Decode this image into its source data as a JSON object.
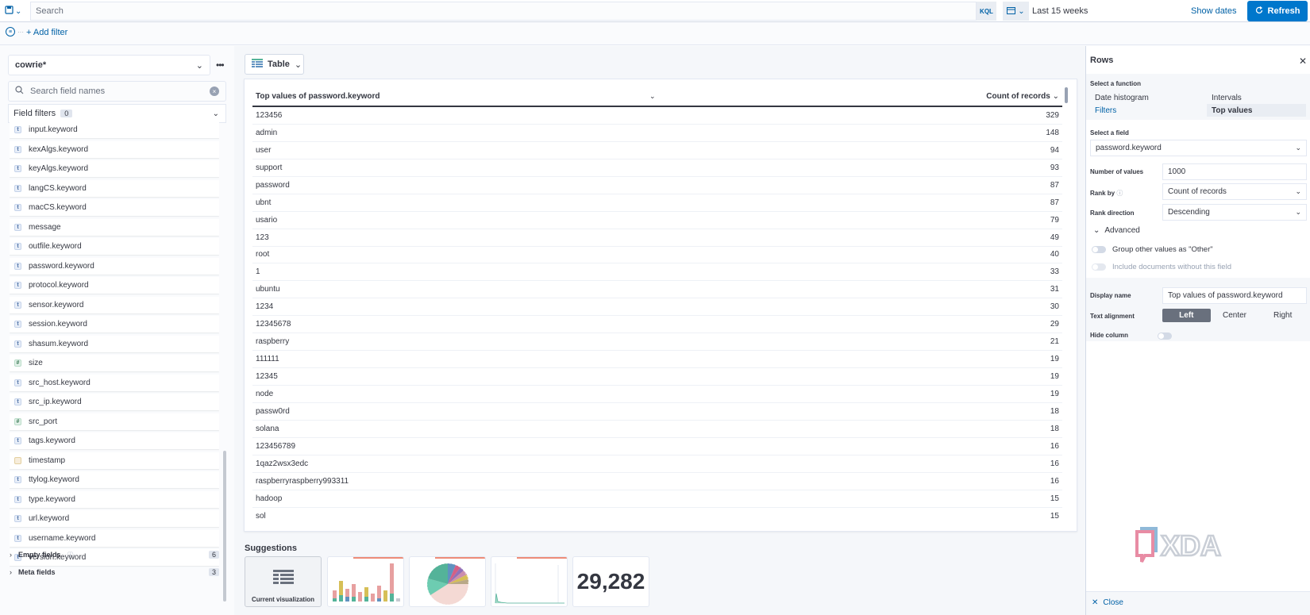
{
  "topbar": {
    "search_placeholder": "Search",
    "kql_label": "KQL",
    "date_range": "Last 15 weeks",
    "show_dates": "Show dates",
    "refresh": "Refresh"
  },
  "filters": {
    "add_filter": "+ Add filter"
  },
  "left_panel": {
    "index_pattern": "cowrie*",
    "field_search_placeholder": "Search field names",
    "field_filters_label": "Field filters",
    "field_filters_count": "0",
    "fields": [
      {
        "name": "input.keyword",
        "type": "string",
        "icon": "t"
      },
      {
        "name": "kexAlgs.keyword",
        "type": "string",
        "icon": "t"
      },
      {
        "name": "keyAlgs.keyword",
        "type": "string",
        "icon": "t"
      },
      {
        "name": "langCS.keyword",
        "type": "string",
        "icon": "t"
      },
      {
        "name": "macCS.keyword",
        "type": "string",
        "icon": "t"
      },
      {
        "name": "message",
        "type": "string",
        "icon": "t"
      },
      {
        "name": "outfile.keyword",
        "type": "string",
        "icon": "t"
      },
      {
        "name": "password.keyword",
        "type": "string",
        "icon": "t"
      },
      {
        "name": "protocol.keyword",
        "type": "string",
        "icon": "t"
      },
      {
        "name": "sensor.keyword",
        "type": "string",
        "icon": "t"
      },
      {
        "name": "session.keyword",
        "type": "string",
        "icon": "t"
      },
      {
        "name": "shasum.keyword",
        "type": "string",
        "icon": "t"
      },
      {
        "name": "size",
        "type": "number",
        "icon": "#"
      },
      {
        "name": "src_host.keyword",
        "type": "string",
        "icon": "t"
      },
      {
        "name": "src_ip.keyword",
        "type": "string",
        "icon": "t"
      },
      {
        "name": "src_port",
        "type": "number",
        "icon": "#"
      },
      {
        "name": "tags.keyword",
        "type": "string",
        "icon": "t"
      },
      {
        "name": "timestamp",
        "type": "date",
        "icon": ""
      },
      {
        "name": "ttylog.keyword",
        "type": "string",
        "icon": "t"
      },
      {
        "name": "type.keyword",
        "type": "string",
        "icon": "t"
      },
      {
        "name": "url.keyword",
        "type": "string",
        "icon": "t"
      },
      {
        "name": "username.keyword",
        "type": "string",
        "icon": "t"
      },
      {
        "name": "version.keyword",
        "type": "string",
        "icon": "t"
      }
    ],
    "empty_fields_label": "Empty fields",
    "empty_fields_count": "6",
    "meta_fields_label": "Meta fields",
    "meta_fields_count": "3"
  },
  "main": {
    "chart_type": "Table",
    "table": {
      "col_left": "Top values of password.keyword",
      "col_right": "Count of records",
      "rows": [
        [
          "123456",
          "329"
        ],
        [
          "admin",
          "148"
        ],
        [
          "user",
          "94"
        ],
        [
          "support",
          "93"
        ],
        [
          "password",
          "87"
        ],
        [
          "ubnt",
          "87"
        ],
        [
          "usario",
          "79"
        ],
        [
          "123",
          "49"
        ],
        [
          "root",
          "40"
        ],
        [
          "1",
          "33"
        ],
        [
          "ubuntu",
          "31"
        ],
        [
          "1234",
          "30"
        ],
        [
          "12345678",
          "29"
        ],
        [
          "raspberry",
          "21"
        ],
        [
          "111111",
          "19"
        ],
        [
          "12345",
          "19"
        ],
        [
          "node",
          "19"
        ],
        [
          "passw0rd",
          "18"
        ],
        [
          "solana",
          "18"
        ],
        [
          "123456789",
          "16"
        ],
        [
          "1qaz2wsx3edc",
          "16"
        ],
        [
          "raspberryraspberry993311",
          "16"
        ],
        [
          "hadoop",
          "15"
        ],
        [
          "sol",
          "15"
        ]
      ]
    },
    "suggestions_title": "Suggestions",
    "current_viz_label": "Current visualization",
    "metric_value": "29,282"
  },
  "right_panel": {
    "title": "Rows",
    "select_function_label": "Select a function",
    "functions": {
      "date_histogram": "Date histogram",
      "intervals": "Intervals",
      "filters": "Filters",
      "top_values": "Top values"
    },
    "select_field_label": "Select a field",
    "field_value": "password.keyword",
    "number_of_values_label": "Number of values",
    "number_of_values": "1000",
    "rank_by_label": "Rank by",
    "rank_by_value": "Count of records",
    "rank_direction_label": "Rank direction",
    "rank_direction_value": "Descending",
    "advanced_label": "Advanced",
    "group_other_label": "Group other values as \"Other\"",
    "include_docs_label": "Include documents without this field",
    "display_name_label": "Display name",
    "display_name_value": "Top values of password.keyword",
    "text_alignment_label": "Text alignment",
    "align_left": "Left",
    "align_center": "Center",
    "align_right": "Right",
    "hide_column_label": "Hide column",
    "close_label": "Close"
  },
  "colors": {
    "accent": "#0077cc",
    "link": "#0061a6",
    "text": "#343741"
  }
}
